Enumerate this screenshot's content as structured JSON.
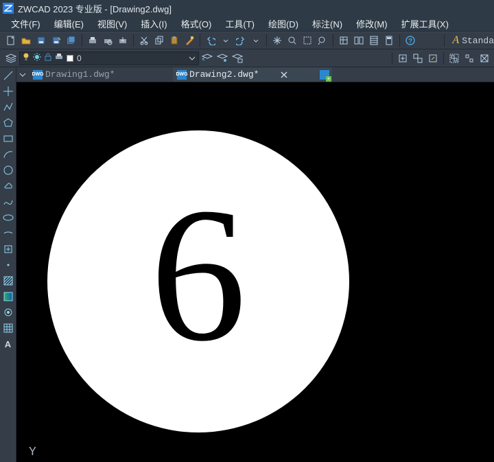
{
  "title": "ZWCAD 2023 专业版 - [Drawing2.dwg]",
  "menu": [
    "文件(F)",
    "编辑(E)",
    "视图(V)",
    "插入(I)",
    "格式(O)",
    "工具(T)",
    "绘图(D)",
    "标注(N)",
    "修改(M)",
    "扩展工具(X)"
  ],
  "style_label": "Standa",
  "layer": {
    "name": "0"
  },
  "tabs": [
    {
      "label": "Drawing1.dwg*",
      "active": false
    },
    {
      "label": "Drawing2.dwg*",
      "active": true
    }
  ],
  "canvas": {
    "glyph": "6",
    "axis_label": "Y"
  },
  "dwg_badge": "DWG"
}
